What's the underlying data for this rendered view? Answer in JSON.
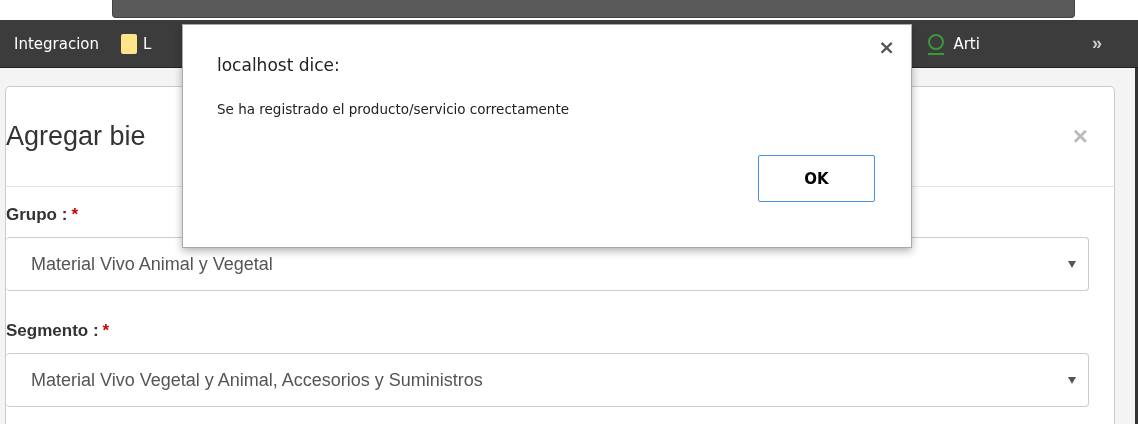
{
  "bookmarks_bar": {
    "items": [
      {
        "label": "Integracion",
        "kind": "text"
      },
      {
        "label": "L",
        "kind": "folder"
      },
      {
        "label": "Arti",
        "kind": "ring"
      }
    ],
    "more": "»"
  },
  "modal": {
    "title": "Agregar bie",
    "close": "×",
    "fields": [
      {
        "label": "Grupo :",
        "mark": "*",
        "value": "Material Vivo Animal y Vegetal"
      },
      {
        "label": "Segmento :",
        "mark": "*",
        "value": "Material Vivo Vegetal y Animal, Accesorios y Suministros"
      }
    ]
  },
  "dialog": {
    "title": "localhost dice:",
    "message": "Se ha registrado el producto/servicio correctamente",
    "close": "×",
    "button": "OK"
  }
}
